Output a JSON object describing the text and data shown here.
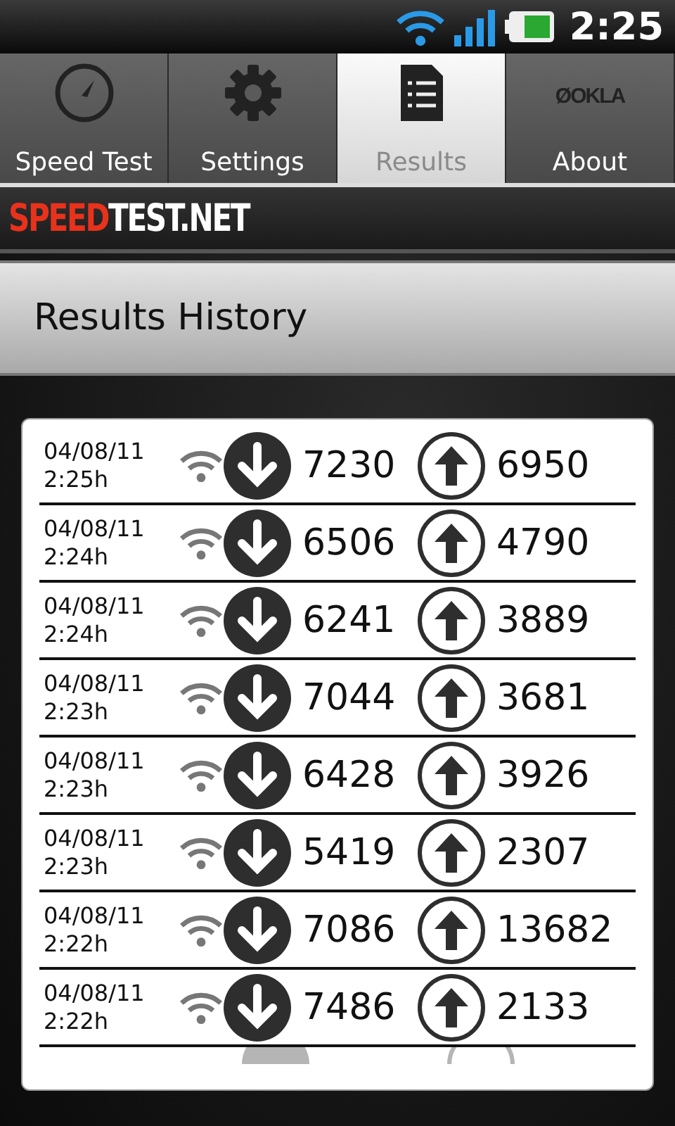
{
  "status_bar": {
    "time": "2:25"
  },
  "tabs": [
    {
      "label": "Speed Test",
      "kind": "gauge",
      "selected": false
    },
    {
      "label": "Settings",
      "kind": "gear",
      "selected": false
    },
    {
      "label": "Results",
      "kind": "document",
      "selected": true
    },
    {
      "label": "About",
      "kind": "logo",
      "logo": "ØOKLA",
      "selected": false
    }
  ],
  "logo": [
    "SPEED",
    "TEST.NET"
  ],
  "header": {
    "title": "Results History"
  },
  "results": [
    {
      "date": "04/08/11",
      "time": "2:25h",
      "download": "7230",
      "upload": "6950"
    },
    {
      "date": "04/08/11",
      "time": "2:24h",
      "download": "6506",
      "upload": "4790"
    },
    {
      "date": "04/08/11",
      "time": "2:24h",
      "download": "6241",
      "upload": "3889"
    },
    {
      "date": "04/08/11",
      "time": "2:23h",
      "download": "7044",
      "upload": "3681"
    },
    {
      "date": "04/08/11",
      "time": "2:23h",
      "download": "6428",
      "upload": "3926"
    },
    {
      "date": "04/08/11",
      "time": "2:23h",
      "download": "5419",
      "upload": "2307"
    },
    {
      "date": "04/08/11",
      "time": "2:22h",
      "download": "7086",
      "upload": "13682"
    },
    {
      "date": "04/08/11",
      "time": "2:22h",
      "download": "7486",
      "upload": "2133"
    }
  ]
}
